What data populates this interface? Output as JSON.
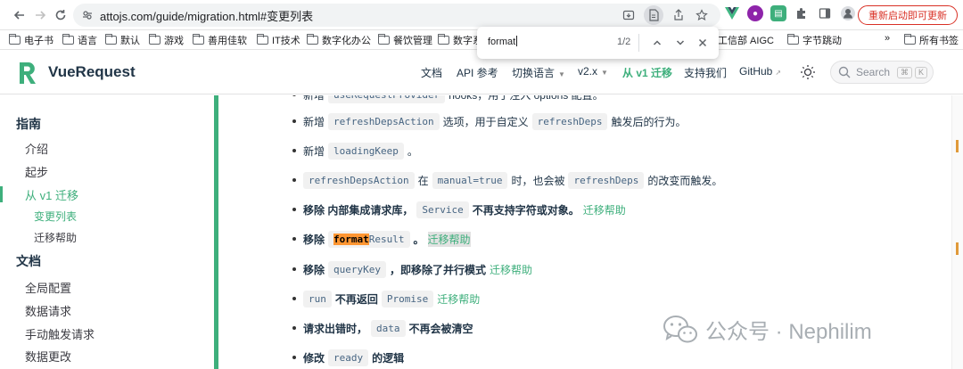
{
  "browser": {
    "url": "attojs.com/guide/migration.html#变更列表",
    "update_label": "重新启动即可更新",
    "bookmarks": [
      "电子书",
      "语言",
      "默认",
      "游戏",
      "善用佳软",
      "IT技术",
      "数字化办公",
      "餐饮管理",
      "数字系",
      "工信部 AIGC",
      "字节跳动",
      "所有书签"
    ],
    "bookmarks_more": "»"
  },
  "find": {
    "query": "format",
    "count": "1/2"
  },
  "site": {
    "title": "VueRequest",
    "nav": [
      "文档",
      "API 参考",
      "切换语言",
      "v2.x",
      "从 v1 迁移",
      "支持我们",
      "GitHub"
    ],
    "search_placeholder": "Search",
    "search_kbd": [
      "⌘",
      "K"
    ]
  },
  "sidebar": {
    "section_guide": "指南",
    "item_intro": "介绍",
    "item_start": "起步",
    "item_migrate": "从 v1 迁移",
    "sub_changes": "变更列表",
    "sub_help": "迁移帮助",
    "section_docs": "文档",
    "item_global": "全局配置",
    "item_request": "数据请求",
    "item_manual": "手动触发请求",
    "item_mutate": "数据更改"
  },
  "content": {
    "line0": {
      "pre": "新增",
      "code": "useRequestProvider",
      "post": "hooks，用于注入 options 配置。"
    },
    "line1": {
      "pre": "新增",
      "code": "refreshDepsAction",
      "mid": "选项，用于自定义",
      "code2": "refreshDeps",
      "post": "触发后的行为。"
    },
    "line2": {
      "pre": "新增",
      "code": "loadingKeep",
      "post": "。"
    },
    "line3": {
      "code": "refreshDepsAction",
      "mid": "在",
      "code2": "manual=true",
      "mid2": "时，也会被",
      "code3": "refreshDeps",
      "post": "的改变而触发。"
    },
    "line4": {
      "pre": "移除 内部集成请求库，",
      "code": "Service",
      "post": "不再支持字符或对象。",
      "link": "迁移帮助"
    },
    "line5": {
      "pre": "移除",
      "code_hl": "format",
      "code": "Result",
      "post": "。",
      "link": "迁移帮助"
    },
    "line6": {
      "pre": "移除",
      "code": "queryKey",
      "post": "，即移除了并行模式",
      "link": "迁移帮助"
    },
    "line7": {
      "code": "run",
      "mid": "不再返回",
      "code2": "Promise",
      "link": "迁移帮助"
    },
    "line8": {
      "pre": "请求出错时，",
      "code": "data",
      "post": "不再会被清空"
    },
    "line9": {
      "pre": "修改",
      "code": "ready",
      "post": "的逻辑"
    }
  },
  "watermark": {
    "text": "公众号 · Nephilim"
  },
  "colors": {
    "accent": "#3eaf7c",
    "highlight": "#ff9632",
    "danger": "#d93025"
  }
}
